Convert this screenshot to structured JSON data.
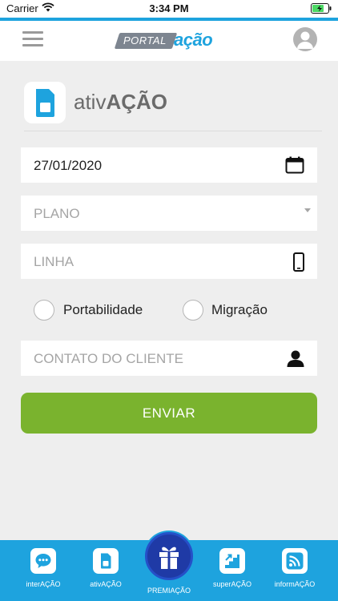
{
  "status_bar": {
    "carrier": "Carrier",
    "time": "3:34 PM"
  },
  "header": {
    "logo_portal": "PORTAL",
    "logo_acao": "ação"
  },
  "section": {
    "title_prefix": "ativ",
    "title_suffix": "AÇÃO"
  },
  "form": {
    "date_value": "27/01/2020",
    "plano_placeholder": "PLANO",
    "linha_placeholder": "LINHA",
    "radio_options": [
      "Portabilidade",
      "Migração"
    ],
    "contato_placeholder": "CONTATO DO CLIENTE",
    "submit_label": "ENVIAR"
  },
  "bottom_nav": {
    "items": [
      {
        "label": "interAÇÃO",
        "icon": "chat-icon"
      },
      {
        "label": "ativAÇÃO",
        "icon": "sim-card-icon"
      },
      {
        "label": "PREMIAÇÃO",
        "icon": "gift-icon"
      },
      {
        "label": "superAÇÃO",
        "icon": "stairs-icon"
      },
      {
        "label": "informAÇÃO",
        "icon": "rss-icon"
      }
    ]
  },
  "colors": {
    "brand_blue": "#1ea3de",
    "submit_green": "#7ab32e",
    "center_button": "#1f3aa6",
    "background": "#eeeeee"
  }
}
